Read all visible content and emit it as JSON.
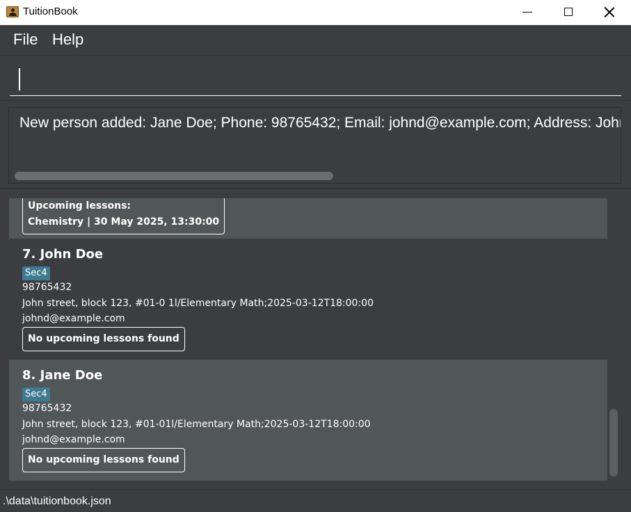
{
  "window": {
    "title": "TuitionBook",
    "app_icon": "contact-book-icon",
    "controls": [
      "minimize-icon",
      "maximize-icon",
      "close-icon"
    ]
  },
  "menu": {
    "file_label": "File",
    "help_label": "Help"
  },
  "command_box": {
    "value": ""
  },
  "result_display": {
    "text": "New person added: Jane Doe; Phone: 98765432; Email: johnd@example.com; Address: John str"
  },
  "person_list": {
    "partial_card": {
      "lessons_header": "Upcoming lessons:",
      "lesson": "Chemistry | 30 May 2025, 13:30:00"
    },
    "cards": [
      {
        "name": "7. John Doe",
        "tag": "Sec4",
        "phone": "98765432",
        "address": "John street, block 123, #01-0 1l/Elementary Math;2025-03-12T18:00:00",
        "email": "johnd@example.com",
        "lessons": "No upcoming lessons found"
      },
      {
        "name": "8. Jane Doe",
        "tag": "Sec4",
        "phone": "98765432",
        "address": "John street, block 123, #01-01l/Elementary Math;2025-03-12T18:00:00",
        "email": "johnd@example.com",
        "lessons": "No upcoming lessons found"
      }
    ]
  },
  "status_bar": {
    "path": ".\\data\\tuitionbook.json"
  },
  "colors": {
    "background": "#3b3d40",
    "card_selected": "#515658",
    "tag": "#3e7b91"
  }
}
